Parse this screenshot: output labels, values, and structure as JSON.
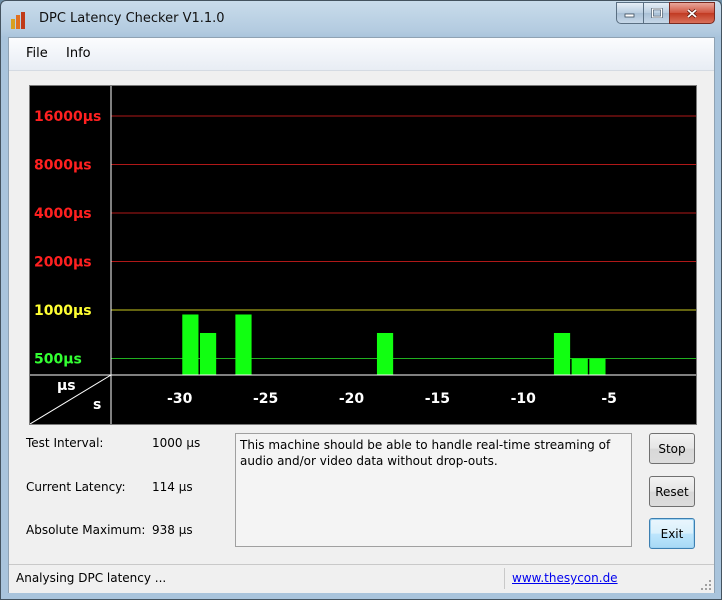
{
  "window": {
    "title": "DPC Latency Checker V1.1.0",
    "controls": {
      "minimize": "minimize-icon",
      "maximize": "maximize-icon",
      "close": "close-icon"
    }
  },
  "menu": {
    "items": [
      "File",
      "Info"
    ]
  },
  "chart_data": {
    "type": "bar",
    "y_scale": "log2",
    "ylabel": "µs",
    "xlabel": "s",
    "y_ticks": [
      {
        "label": "16000µs",
        "value": 16000,
        "color": "#ff2020"
      },
      {
        "label": "8000µs",
        "value": 8000,
        "color": "#ff2020"
      },
      {
        "label": "4000µs",
        "value": 4000,
        "color": "#ff2020"
      },
      {
        "label": "2000µs",
        "value": 2000,
        "color": "#ff2020"
      },
      {
        "label": "1000µs",
        "value": 1000,
        "color": "#ffff33"
      },
      {
        "label": "500µs",
        "value": 500,
        "color": "#33ff33"
      }
    ],
    "x_ticks": [
      -30,
      -25,
      -20,
      -15,
      -10,
      -5
    ],
    "x_range": [
      -34,
      0
    ],
    "series": [
      {
        "values": [
          230,
          180,
          200,
          210,
          938,
          720,
          200,
          938,
          170,
          150,
          230,
          170,
          160,
          210,
          180,
          720,
          200,
          220,
          170,
          170,
          160,
          180,
          150,
          160,
          170,
          720,
          500,
          500,
          160,
          170,
          150,
          190,
          230
        ]
      }
    ],
    "bar_color": "#11ff11",
    "grid": true
  },
  "info": {
    "test_interval_label": "Test Interval:",
    "test_interval_value": "1000 µs",
    "current_latency_label": "Current Latency:",
    "current_latency_value": "114 µs",
    "absolute_maximum_label": "Absolute Maximum:",
    "absolute_maximum_value": "938 µs"
  },
  "message": "This machine should be able to handle real-time streaming of audio and/or video data without drop-outs.",
  "buttons": {
    "stop": "Stop",
    "reset": "Reset",
    "exit": "Exit"
  },
  "status": {
    "text": "Analysing DPC latency ...",
    "link": "www.thesycon.de"
  }
}
